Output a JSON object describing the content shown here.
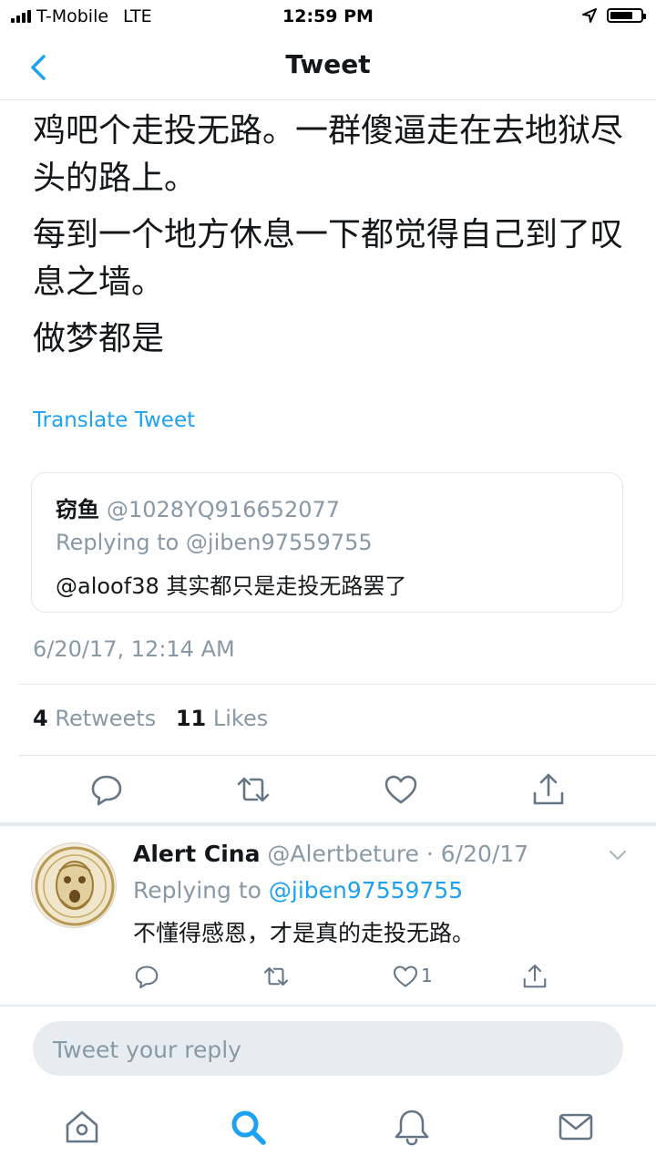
{
  "status_bar": {
    "carrier": "T-Mobile",
    "network": "LTE",
    "time": "12:59 PM",
    "battery_level": 0.75,
    "icons": [
      "signal-bars-icon",
      "location-arrow-icon",
      "battery-icon"
    ]
  },
  "nav": {
    "title": "Tweet",
    "back_icon": "chevron-left-icon"
  },
  "tweet": {
    "paragraphs": [
      "鸡吧个走投无路。一群傻逼走在去地狱尽头的路上。",
      "每到一个地方休息一下都觉得自己到了叹息之墙。",
      "做梦都是"
    ],
    "translate_label": "Translate Tweet",
    "quoted": {
      "name": "窃鱼",
      "handle": "@1028YQ916652077",
      "replying_to": "Replying to @jiben97559755",
      "text": "@aloof38 其实都只是走投无路罢了"
    },
    "timestamp": "6/20/17, 12:14 AM",
    "retweets_count": "4",
    "retweets_label": "Retweets",
    "likes_count": "11",
    "likes_label": "Likes",
    "actions": [
      "reply-icon",
      "retweet-icon",
      "like-icon",
      "share-icon"
    ]
  },
  "reply": {
    "name": "Alert Cina",
    "meta": "@Alertbeture · 6/20/17",
    "replying_prefix": "Replying to",
    "replying_handle": "@jiben97559755",
    "text": "不懂得感恩，才是真的走投无路。",
    "like_count": "1"
  },
  "composer": {
    "placeholder": "Tweet your reply"
  },
  "tab_bar": {
    "tabs": [
      "home-icon",
      "search-icon",
      "notifications-bell-icon",
      "messages-envelope-icon"
    ],
    "active": "search-icon"
  },
  "colors": {
    "accent": "#1da1f2",
    "muted": "#8899a6",
    "text": "#14171a",
    "divider": "#e1e8ed"
  }
}
